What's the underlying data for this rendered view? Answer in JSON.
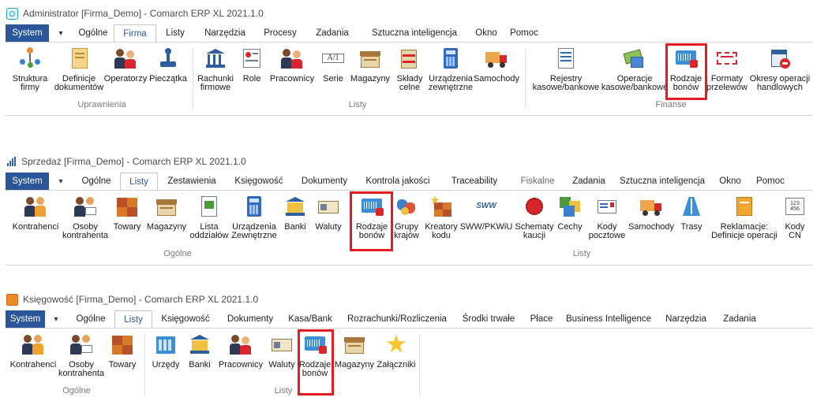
{
  "windows": [
    {
      "title": "Administrator [Firma_Demo] - Comarch ERP XL 2021.1.0",
      "tabs": [
        "System",
        "Ogólne",
        "Firma",
        "Listy",
        "Narzędzia",
        "Procesy",
        "Zadania",
        "Sztuczna inteligencja",
        "Okno",
        "Pomoc"
      ],
      "active_tab": "Firma",
      "buttons": [
        {
          "label": "Struktura\nfirmy",
          "icon": "org-structure-icon"
        },
        {
          "label": "Definicje\ndokumentów",
          "icon": "document-definitions-icon"
        },
        {
          "label": "Operatorzy",
          "icon": "operators-icon"
        },
        {
          "label": "Pieczątka",
          "icon": "stamp-icon"
        },
        {
          "label": "Rachunki\nfirmowe",
          "icon": "bank-accounts-icon"
        },
        {
          "label": "Role",
          "icon": "roles-icon"
        },
        {
          "label": "Pracownicy",
          "icon": "employees-icon"
        },
        {
          "label": "Serie",
          "icon": "series-icon"
        },
        {
          "label": "Magazyny",
          "icon": "warehouses-icon"
        },
        {
          "label": "Składy\ncelne",
          "icon": "customs-warehouses-icon"
        },
        {
          "label": "Urządzenia\nzewnętrzne",
          "icon": "external-devices-icon"
        },
        {
          "label": "Samochody",
          "icon": "truck-icon"
        },
        {
          "label": "Rejestry\nkasowe/bankowe",
          "icon": "cash-registers-icon"
        },
        {
          "label": "Operacje\nkasowe/bankowe",
          "icon": "cash-operations-icon"
        },
        {
          "label": "Rodzaje\nbonów",
          "icon": "voucher-types-icon"
        },
        {
          "label": "Formaty\nprzelewów",
          "icon": "transfer-formats-icon"
        },
        {
          "label": "Okresy operacji\nhandlowych",
          "icon": "trade-periods-icon"
        }
      ],
      "groups": [
        "Uprawnienia",
        "Listy",
        "Finanse"
      ]
    },
    {
      "title": "Sprzedaż [Firma_Demo] - Comarch ERP XL 2021.1.0",
      "tabs": [
        "System",
        "Ogólne",
        "Listy",
        "Zestawienia",
        "Księgowość",
        "Dokumenty",
        "Kontrola jakości",
        "Traceability",
        "Fiskalne",
        "Zadania",
        "Sztuczna inteligencja",
        "Okno",
        "Pomoc"
      ],
      "active_tab": "Listy",
      "buttons": [
        {
          "label": "Kontrahenci",
          "icon": "contractors-icon"
        },
        {
          "label": "Osoby\nkontrahenta",
          "icon": "contractor-persons-icon"
        },
        {
          "label": "Towary",
          "icon": "goods-icon"
        },
        {
          "label": "Magazyny",
          "icon": "warehouses-icon"
        },
        {
          "label": "Lista\noddziałów",
          "icon": "branches-icon"
        },
        {
          "label": "Urządzenia\nZewnętrzne",
          "icon": "external-devices-icon"
        },
        {
          "label": "Banki",
          "icon": "banks-icon"
        },
        {
          "label": "Waluty",
          "icon": "currencies-icon"
        },
        {
          "label": "Rodzaje\nbonów",
          "icon": "voucher-types-icon"
        },
        {
          "label": "Grupy\nkrajów",
          "icon": "country-groups-icon"
        },
        {
          "label": "Kreatory\nkodu",
          "icon": "code-creators-icon"
        },
        {
          "label": "SWW/PKWiU",
          "icon": "sww-icon"
        },
        {
          "label": "Schematy\nkaucji",
          "icon": "deposit-schemes-icon"
        },
        {
          "label": "Cechy",
          "icon": "features-icon"
        },
        {
          "label": "Kody\npocztowe",
          "icon": "postal-codes-icon"
        },
        {
          "label": "Samochody",
          "icon": "truck-icon"
        },
        {
          "label": "Trasy",
          "icon": "routes-icon"
        },
        {
          "label": "Reklamacje:\nDefinicje operacji",
          "icon": "complaints-icon"
        },
        {
          "label": "Kody\nCN",
          "icon": "cn-codes-icon"
        }
      ],
      "groups": [
        "Ogólne",
        "Listy"
      ]
    },
    {
      "title": "Księgowość [Firma_Demo] - Comarch ERP XL 2021.1.0",
      "tabs": [
        "System",
        "Ogólne",
        "Listy",
        "Księgowość",
        "Dokumenty",
        "Kasa/Bank",
        "Rozrachunki/Rozliczenia",
        "Środki trwałe",
        "Płace",
        "Business Intelligence",
        "Narzędzia",
        "Zadania"
      ],
      "active_tab": "Listy",
      "buttons": [
        {
          "label": "Kontrahenci",
          "icon": "contractors-icon"
        },
        {
          "label": "Osoby\nkontrahenta",
          "icon": "contractor-persons-icon"
        },
        {
          "label": "Towary",
          "icon": "goods-icon"
        },
        {
          "label": "Urzędy",
          "icon": "offices-icon"
        },
        {
          "label": "Banki",
          "icon": "banks-icon"
        },
        {
          "label": "Pracownicy",
          "icon": "employees-icon"
        },
        {
          "label": "Waluty",
          "icon": "currencies-icon"
        },
        {
          "label": "Rodzaje\nbonów",
          "icon": "voucher-types-icon"
        },
        {
          "label": "Magazyny",
          "icon": "warehouses-icon"
        },
        {
          "label": "Załączniki",
          "icon": "attachments-icon"
        }
      ],
      "groups": [
        "Ogólne",
        "Listy"
      ]
    }
  ],
  "colors": {
    "system_tab": "#2b579a",
    "highlight": "#e31b23"
  }
}
